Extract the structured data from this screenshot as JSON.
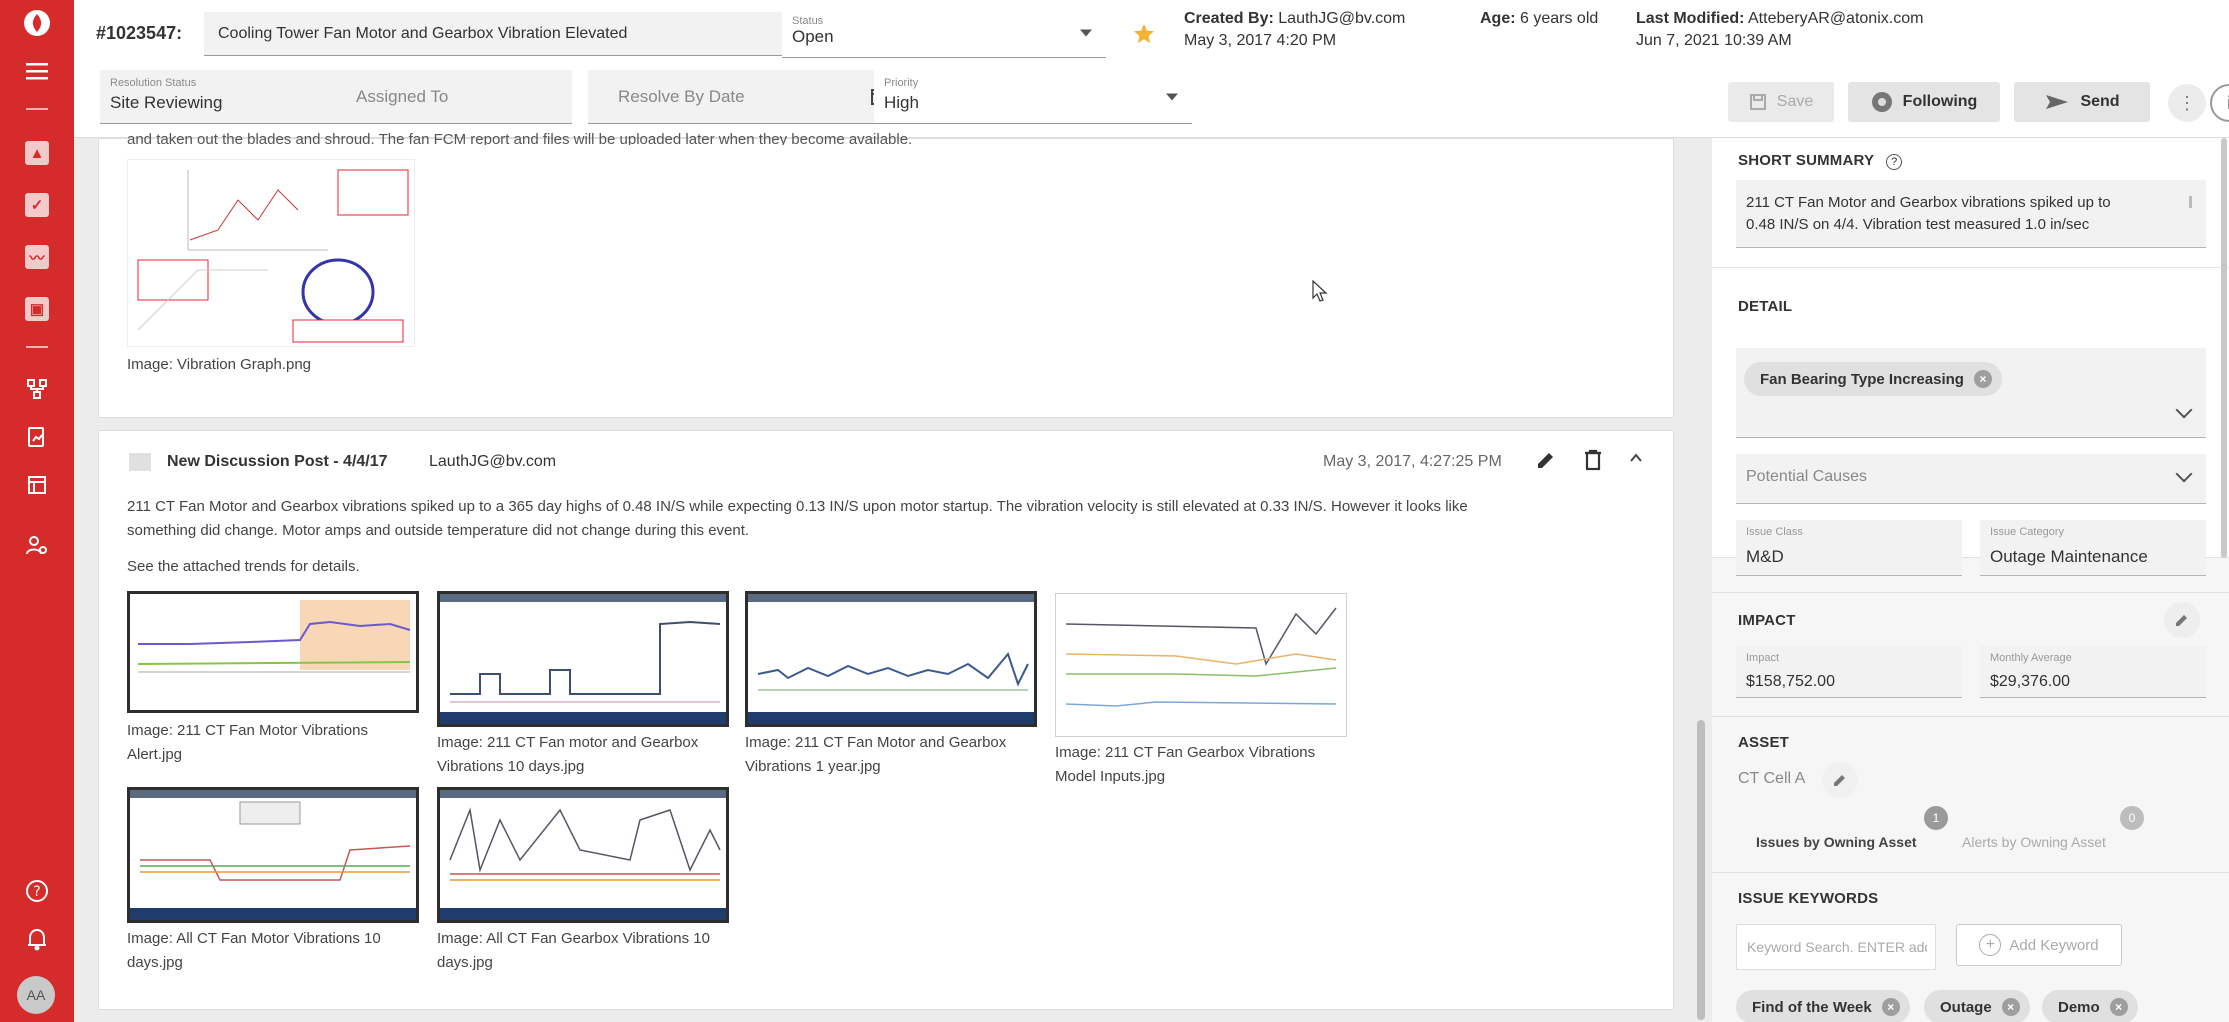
{
  "header": {
    "issue_id": "#1023547:",
    "title": "Cooling Tower Fan Motor and Gearbox Vibration Elevated",
    "status_label": "Status",
    "status_value": "Open",
    "created_by_label": "Created By:",
    "created_by": "LauthJG@bv.com",
    "created_date": "May 3, 2017 4:20 PM",
    "age_label": "Age:",
    "age": "6 years old",
    "modified_label": "Last Modified:",
    "modified_by": "AtteberyAR@atonix.com",
    "modified_date": "Jun 7, 2021 10:39 AM",
    "resolution_label": "Resolution Status",
    "resolution_value": "Site Reviewing",
    "assigned_placeholder": "Assigned To",
    "resolve_placeholder": "Resolve By Date",
    "priority_label": "Priority",
    "priority_value": "High",
    "save_label": "Save",
    "following_label": "Following",
    "send_label": "Send"
  },
  "post1": {
    "clipped_text": "and taken out the blades and shroud. The fan FCM report and files will be uploaded later when they become available.",
    "image_caption": "Image: Vibration Graph.png"
  },
  "post2": {
    "title": "New Discussion Post - 4/4/17",
    "author": "LauthJG@bv.com",
    "timestamp": "May 3, 2017, 4:27:25 PM",
    "body_line1": "211 CT Fan Motor and Gearbox vibrations spiked up to a 365 day highs of 0.48 IN/S while expecting 0.13 IN/S upon motor startup.  The vibration velocity is still elevated at 0.33 IN/S. However it looks like",
    "body_line2": "something did change.  Motor amps and outside temperature did not change during this event.",
    "body_line3": "See the attached trends for details.",
    "images": [
      {
        "caption1": "Image: 211 CT Fan Motor Vibrations",
        "caption2": "Alert.jpg"
      },
      {
        "caption1": "Image: 211 CT Fan motor and Gearbox",
        "caption2": "Vibrations 10 days.jpg"
      },
      {
        "caption1": "Image: 211 CT Fan Motor and Gearbox",
        "caption2": "Vibrations 1 year.jpg"
      },
      {
        "caption1": "Image: 211 CT Fan Gearbox Vibrations",
        "caption2": "Model Inputs.jpg"
      },
      {
        "caption1": "Image: All CT Fan Motor Vibrations 10",
        "caption2": "days.jpg"
      },
      {
        "caption1": "Image: All CT Fan Gearbox Vibrations 10",
        "caption2": "days.jpg"
      }
    ]
  },
  "panel": {
    "short_summary_title": "SHORT SUMMARY",
    "short_summary_line1": "211 CT Fan Motor and Gearbox vibrations spiked up to",
    "short_summary_line2": "0.48 IN/S on 4/4. Vibration test measured 1.0 in/sec",
    "detail_title": "DETAIL",
    "detail_chip": "Fan Bearing Type Increasing",
    "potential_causes": "Potential Causes",
    "issue_class_label": "Issue Class",
    "issue_class": "M&D",
    "issue_category_label": "Issue Category",
    "issue_category": "Outage Maintenance",
    "impact_title": "IMPACT",
    "impact_label": "Impact",
    "impact_value": "$158,752.00",
    "monthly_label": "Monthly Average",
    "monthly_value": "$29,376.00",
    "asset_title": "ASSET",
    "asset_value": "CT Cell A",
    "issues_by_asset": "Issues by Owning Asset",
    "issues_count": "1",
    "alerts_by_asset": "Alerts by Owning Asset",
    "alerts_count": "0",
    "keywords_title": "ISSUE KEYWORDS",
    "keyword_placeholder": "Keyword Search. ENTER adds the ke",
    "add_keyword": "Add Keyword",
    "keywords": [
      "Find of the Week",
      "Outage",
      "Demo"
    ]
  },
  "colors": {
    "accent": "#d52b2b",
    "star": "#f2b233"
  }
}
